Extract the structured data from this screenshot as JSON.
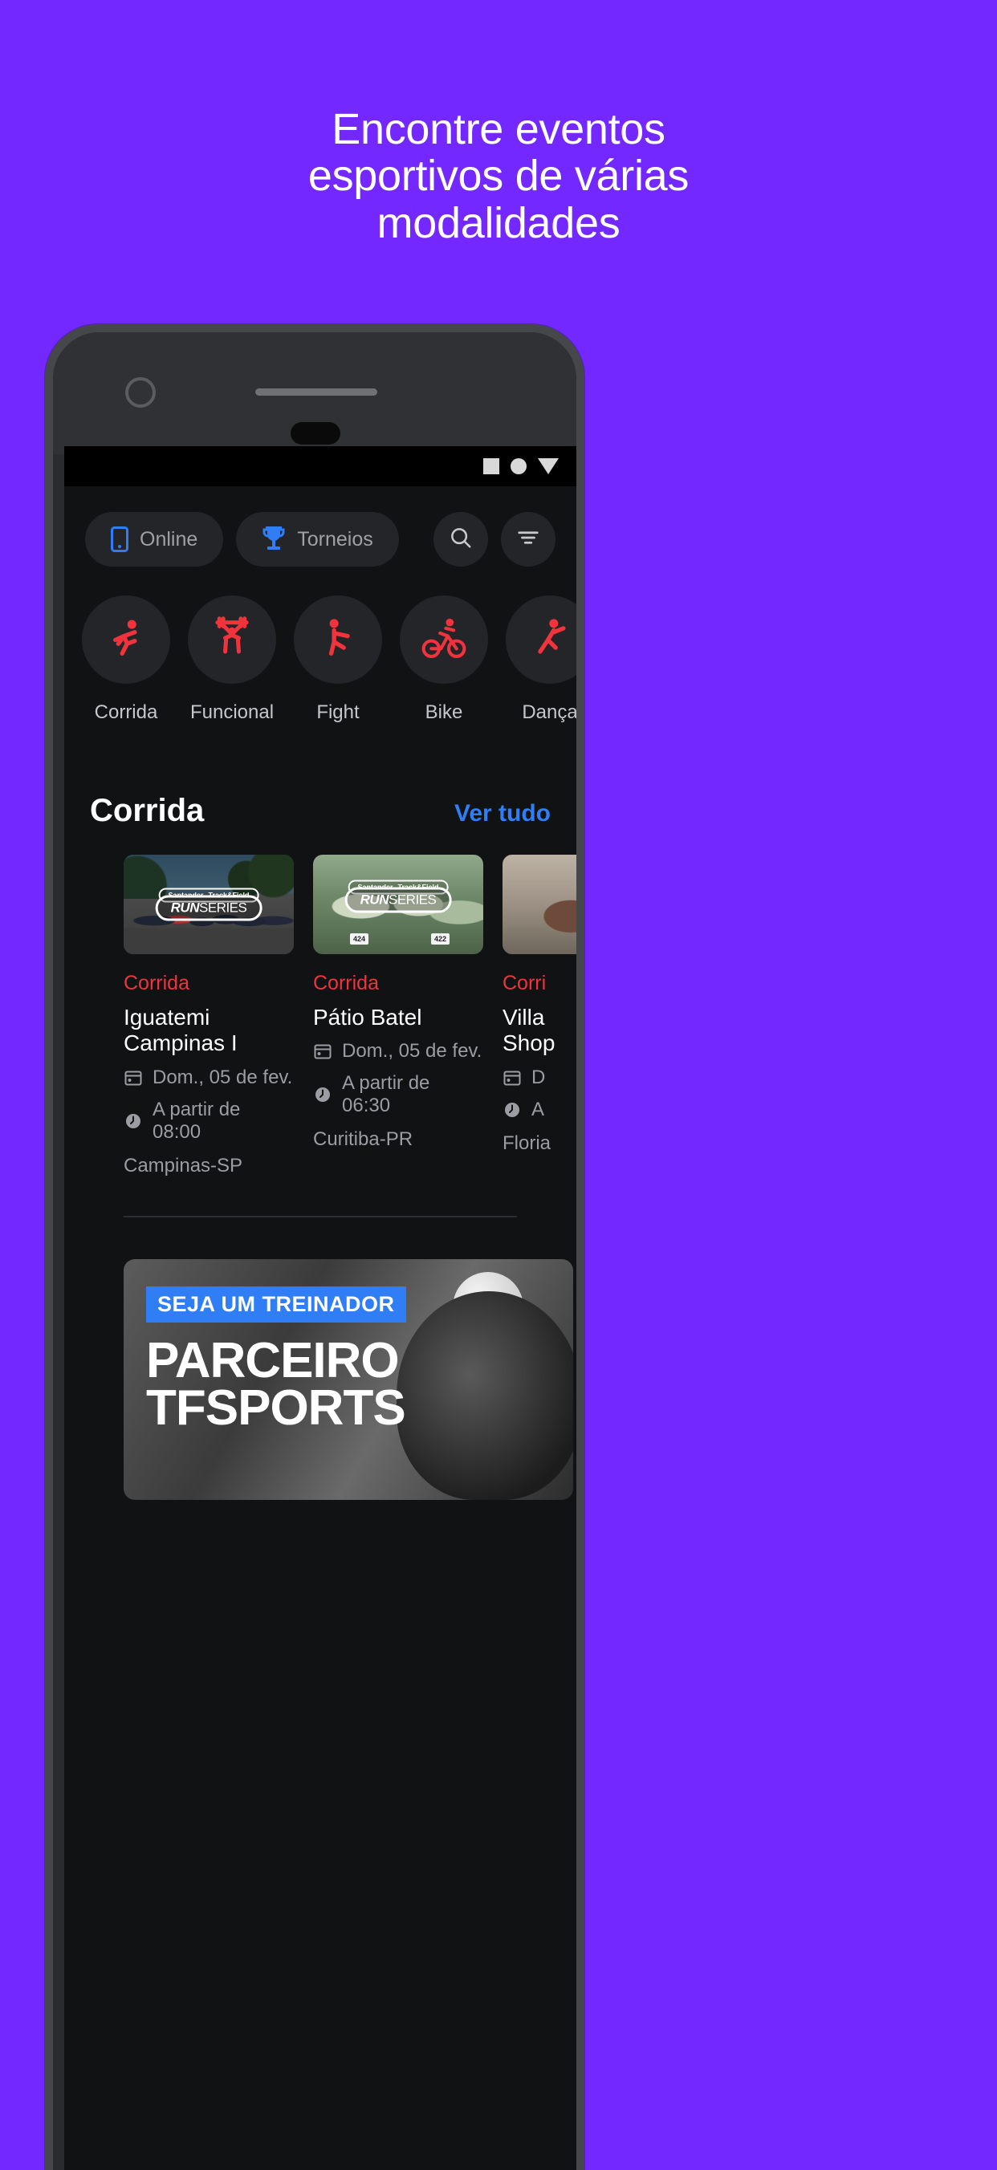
{
  "theme": {
    "background": "#7228FF",
    "accent_blue": "#2F7EF5",
    "accent_red": "#F0333C",
    "screen_bg": "#111214",
    "chip_bg": "#232528"
  },
  "headline": {
    "line1": "Encontre eventos",
    "line2": "esportivos de várias",
    "line3": "modalidades"
  },
  "app": {
    "status_bar": {
      "icons": [
        "square-icon",
        "circle-icon",
        "triangle-down-icon"
      ]
    },
    "filters": {
      "chips": [
        {
          "label": "Online",
          "icon": "mobile-phone-icon"
        },
        {
          "label": "Torneios",
          "icon": "trophy-icon"
        }
      ],
      "search_icon": "search-icon",
      "filter_icon": "filter-sliders-icon"
    },
    "categories": [
      {
        "label": "Corrida",
        "icon": "running-icon"
      },
      {
        "label": "Funcional",
        "icon": "weightlifting-icon"
      },
      {
        "label": "Fight",
        "icon": "kickboxing-icon"
      },
      {
        "label": "Bike",
        "icon": "cycling-icon"
      },
      {
        "label": "Dança",
        "icon": "dancing-icon"
      }
    ],
    "section": {
      "title": "Corrida",
      "see_all": "Ver tudo"
    },
    "events": [
      {
        "tag": "Corrida",
        "title": "Iguatemi Campinas I",
        "date": "Dom., 05 de fev.",
        "time": "A partir de 08:00",
        "location": "Campinas-SP",
        "date_icon": "calendar-icon",
        "time_icon": "clock-icon",
        "image_brand_top_left": "Santander",
        "image_brand_top_right": "Track&Field",
        "image_brand_main_bold": "RUN",
        "image_brand_main_light": "SERIES"
      },
      {
        "tag": "Corrida",
        "title": "Pátio Batel",
        "date": "Dom., 05 de fev.",
        "time": "A partir de 06:30",
        "location": "Curitiba-PR",
        "date_icon": "calendar-icon",
        "time_icon": "clock-icon",
        "image_brand_top_left": "Santander",
        "image_brand_top_right": "Track&Field",
        "image_brand_main_bold": "RUN",
        "image_brand_main_light": "SERIES",
        "bib_numbers": [
          "424",
          "422"
        ]
      },
      {
        "tag": "Corri",
        "title_line1": "Villa",
        "title_line2": "Shop",
        "date": "D",
        "time": "A",
        "location": "Floria",
        "date_icon": "calendar-icon",
        "time_icon": "clock-icon"
      }
    ],
    "promo": {
      "badge": "SEJA UM TREINADOR",
      "title_line1": "PARCEIRO",
      "title_line2": "TFSPORTS"
    }
  }
}
